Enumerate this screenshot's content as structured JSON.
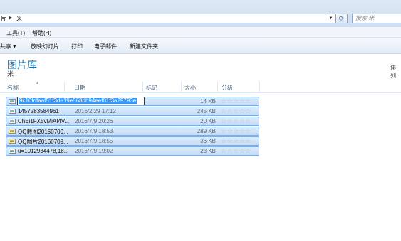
{
  "address_bar": {
    "crumbs": [
      "片",
      "米"
    ],
    "search_placeholder": "搜索 米"
  },
  "menu": {
    "tools": "工具(T)",
    "help": "帮助(H)"
  },
  "commands": {
    "share": "共享 ▾",
    "slideshow": "放映幻灯片",
    "print": "打印",
    "email": "电子邮件",
    "new_folder": "新建文件夹"
  },
  "library": {
    "title": "图片库",
    "subtitle": "米",
    "arrange": "排列"
  },
  "columns": {
    "name": "名称",
    "date": "日期",
    "tags": "标记",
    "size": "大小",
    "rating": "分级"
  },
  "files": [
    {
      "name": "9c16fdfaaf51f3de19e568db94eef01f3a29793e",
      "date": "",
      "size": "14 KB",
      "icon": "image-file-icon",
      "renaming": true
    },
    {
      "name": "1457283584961",
      "date": "2016/2/29 17:12",
      "size": "245 KB",
      "icon": "image-file-icon",
      "renaming": false
    },
    {
      "name": "ChEi1FX5vMiAI4V...",
      "date": "2016/7/9 20:26",
      "size": "20 KB",
      "icon": "image-file-icon",
      "renaming": false
    },
    {
      "name": "QQ截图20160709...",
      "date": "2016/7/9 18:53",
      "size": "289 KB",
      "icon": "qq-image-icon",
      "renaming": false
    },
    {
      "name": "QQ图片20160709...",
      "date": "2016/7/9 18:55",
      "size": "36 KB",
      "icon": "qq-image-icon",
      "renaming": false
    },
    {
      "name": "u=1012934478,18...",
      "date": "2016/7/9 19:02",
      "size": "23 KB",
      "icon": "image-file-icon",
      "renaming": false
    }
  ],
  "rating_stars": "☆☆☆☆☆",
  "colors": {
    "selection": "#3399ff",
    "row_highlight": "#cfe3fa",
    "library_title": "#1a6a9a"
  }
}
